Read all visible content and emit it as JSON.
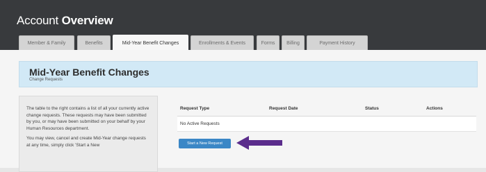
{
  "header": {
    "title_prefix": "Account ",
    "title_bold": "Overview"
  },
  "tabs": [
    {
      "label": "Member & Family",
      "active": false
    },
    {
      "label": "Benefits",
      "active": false
    },
    {
      "label": "Mid-Year Benefit Changes",
      "active": true
    },
    {
      "label": "Enrollments & Events",
      "active": false
    },
    {
      "label": "Forms",
      "active": false
    },
    {
      "label": "Billing",
      "active": false
    },
    {
      "label": "Payment History",
      "active": false
    }
  ],
  "banner": {
    "title": "Mid-Year Benefit Changes",
    "subtitle": "Change Requests"
  },
  "sidebar": {
    "paragraphs": [
      "The table to the right contains a list of all your currently active change requests. These requests may have been submitted by you, or may have been submitted on your behalf by your Human Resources department.",
      "You may view, cancel and create Mid-Year change requests at any time, simply click 'Start a New"
    ]
  },
  "table": {
    "columns": [
      "Request Type",
      "Request Date",
      "Status",
      "Actions"
    ],
    "empty_message": "No Active Requests"
  },
  "new_request_button": "Start a New Request",
  "colors": {
    "header_bg": "#383a3d",
    "banner_bg": "#d2e9f6",
    "button_bg": "#3b87c6",
    "arrow": "#5b2d8c"
  },
  "icons": {
    "annotation": "left-arrow-icon"
  }
}
